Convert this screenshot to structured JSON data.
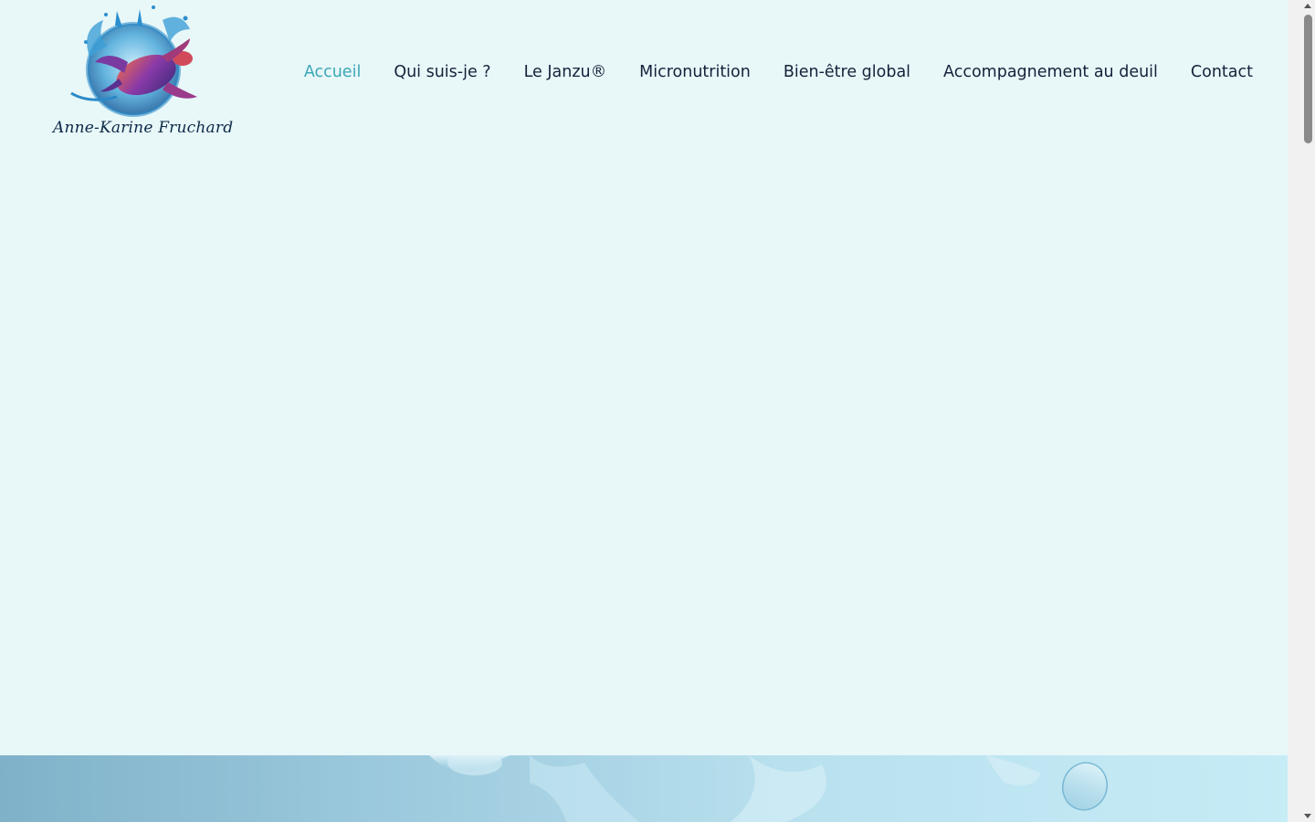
{
  "logo": {
    "text": "Anne-Karine Fruchard",
    "icon": "turtle-water-splash-icon"
  },
  "nav": {
    "items": [
      {
        "label": "Accueil",
        "active": true
      },
      {
        "label": "Qui suis-je ?",
        "active": false
      },
      {
        "label": "Le Janzu®",
        "active": false
      },
      {
        "label": "Micronutrition",
        "active": false
      },
      {
        "label": "Bien-être global",
        "active": false
      },
      {
        "label": "Accompagnement au deuil",
        "active": false
      },
      {
        "label": "Contact",
        "active": false
      }
    ]
  },
  "colors": {
    "background": "#e8f7f8",
    "nav_text": "#16213a",
    "nav_active": "#3aa7b6",
    "logo_text": "#0c2a48"
  }
}
